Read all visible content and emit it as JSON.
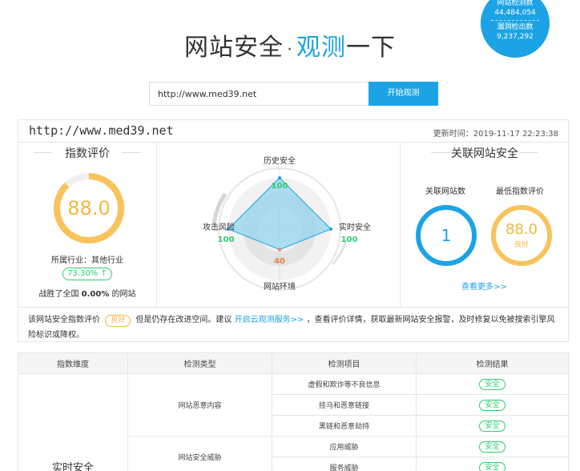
{
  "header": {
    "title_main": "网站安全",
    "title_dot": "·",
    "title_accent": "观测",
    "title_tail": "一下"
  },
  "stats": {
    "checked_label": "网站检测数",
    "checked_value": "44,484,054",
    "vuln_label": "漏洞检出数",
    "vuln_value": "9,237,292"
  },
  "search": {
    "url_value": "http://www.med39.net",
    "button_label": "开始观测"
  },
  "report": {
    "site_url": "http://www.med39.net",
    "update_time": "更新时间：2019-11-17 22:23:38"
  },
  "index_eval": {
    "section_title": "指数评价",
    "score": "88.0",
    "score_fraction": 0.88,
    "industry": "所属行业：其他行业",
    "percent_badge": "73.30% ↑",
    "beat_prefix": "战胜了全国",
    "beat_value": "0.00%",
    "beat_suffix": "的网站"
  },
  "radar": {
    "labels": {
      "top": "历史安全",
      "right": "实时安全",
      "bottom": "网站环境",
      "left": "攻击风险"
    },
    "values": {
      "top": "100",
      "right": "100",
      "bottom": "40",
      "left": "100"
    },
    "colors": {
      "fill": "#8fd3ee",
      "stroke": "#1ba3e6",
      "good": "#2ecc71",
      "warn": "#f0824a"
    }
  },
  "related": {
    "section_title": "关联网站安全",
    "count_label": "关联网站数",
    "count_value": "1",
    "min_label": "最低指数评价",
    "min_value": "88.0",
    "min_grade": "良好",
    "see_more": "查看更多>>"
  },
  "summary": {
    "prefix": "该网站安全指数评价",
    "grade": "良好",
    "middle": "但是仍存在改进空间。建议",
    "link": "开启云观测服务>>",
    "suffix": "，查看评价详情，获取最新网站安全报警，及时修复以免被搜索引擎风险标识或降权。"
  },
  "table": {
    "headers": [
      "指数维度",
      "检测类型",
      "检测项目",
      "检测结果"
    ],
    "dimension": "实时安全",
    "groups": [
      {
        "type": "网站恶意内容",
        "items": [
          "虚假和欺诈等不良信息",
          "挂马和恶意链接",
          "黑链和恶意劫持"
        ]
      },
      {
        "type": "网站安全威胁",
        "items": [
          "应用威胁",
          "服务威胁"
        ]
      }
    ],
    "result": "安全"
  }
}
